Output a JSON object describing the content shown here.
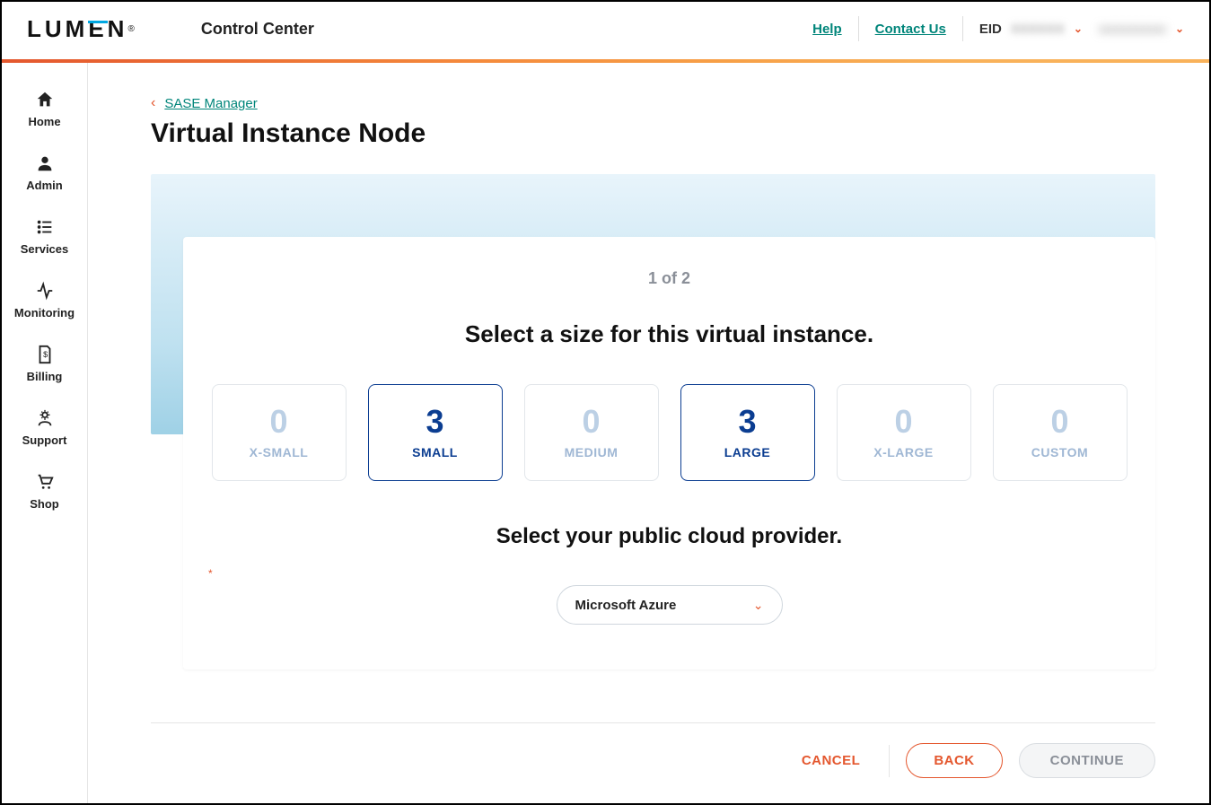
{
  "header": {
    "logo_text": "LUMEN",
    "app_title": "Control Center",
    "help_label": "Help",
    "contact_label": "Contact Us",
    "eid_label": "EID",
    "eid_value": "XXXXXX",
    "user_value": "xxxxxxxxxx"
  },
  "sidebar": {
    "items": [
      {
        "label": "Home"
      },
      {
        "label": "Admin"
      },
      {
        "label": "Services"
      },
      {
        "label": "Monitoring"
      },
      {
        "label": "Billing"
      },
      {
        "label": "Support"
      },
      {
        "label": "Shop"
      }
    ]
  },
  "breadcrumb": {
    "back_label": "SASE Manager"
  },
  "page": {
    "title": "Virtual Instance Node"
  },
  "wizard": {
    "step_text": "1 of 2",
    "size_heading": "Select a size for this virtual instance.",
    "sizes": [
      {
        "count": "0",
        "label": "X-SMALL",
        "active": false
      },
      {
        "count": "3",
        "label": "SMALL",
        "active": true
      },
      {
        "count": "0",
        "label": "MEDIUM",
        "active": false
      },
      {
        "count": "3",
        "label": "LARGE",
        "active": true
      },
      {
        "count": "0",
        "label": "X-LARGE",
        "active": false
      },
      {
        "count": "0",
        "label": "CUSTOM",
        "active": false
      }
    ],
    "provider_heading": "Select your public cloud provider.",
    "provider_selected": "Microsoft Azure"
  },
  "footer": {
    "cancel": "CANCEL",
    "back": "BACK",
    "continue": "CONTINUE"
  }
}
